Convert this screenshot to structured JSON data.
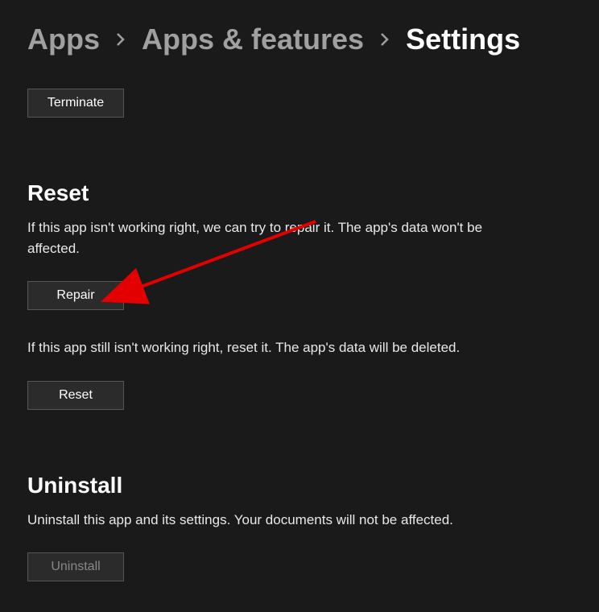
{
  "breadcrumb": {
    "apps": "Apps",
    "apps_features": "Apps & features",
    "current": "Settings"
  },
  "terminate": {
    "button": "Terminate"
  },
  "reset": {
    "heading": "Reset",
    "repair_desc": "If this app isn't working right, we can try to repair it. The app's data won't be affected.",
    "repair_button": "Repair",
    "reset_desc": "If this app still isn't working right, reset it. The app's data will be deleted.",
    "reset_button": "Reset"
  },
  "uninstall": {
    "heading": "Uninstall",
    "desc": "Uninstall this app and its settings. Your documents will not be affected.",
    "button": "Uninstall"
  }
}
